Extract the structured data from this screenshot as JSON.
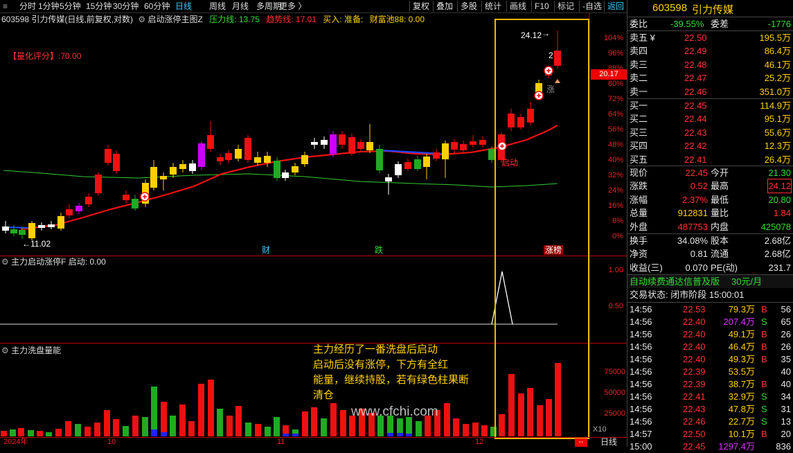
{
  "toolbar": {
    "left": [
      "分时",
      "1分钟",
      "5分钟",
      "15分钟",
      "30分钟",
      "60分钟",
      "日线",
      "周线",
      "月线",
      "多周期",
      "更多 〉"
    ],
    "right": [
      "复权",
      "叠加",
      "多股",
      "统计",
      "画线",
      "F10",
      "标记",
      "-自选",
      "返回"
    ],
    "active_left": "日线",
    "active_right": "返回"
  },
  "main_header": {
    "code_title": "603598 引力传媒(日线,前复权,对数)",
    "indicator": "启动涨停主图Z",
    "pressure": "压力线: 13.75",
    "trend": "趋势线: 17.01",
    "buy": "买入: 准备:",
    "fund": "财富池88: 0.00"
  },
  "quant_score": "【量化评分】:70.00",
  "price_labels": {
    "high_mark": "24.12",
    "low_mark": "11.02",
    "current": "20.17",
    "count_2": "2",
    "zhang": "涨",
    "qidong": "启动"
  },
  "price_axis": [
    "104%",
    "96%",
    "88%",
    "80%",
    "72%",
    "64%",
    "56%",
    "48%",
    "40%",
    "32%",
    "24%",
    "16%",
    "8%",
    "0%"
  ],
  "event_marks": [
    "财",
    "跌",
    "涨榜"
  ],
  "sub1": {
    "title": "主力启动涨停F  启动: 0.00",
    "axis": [
      "1.00",
      "0.50"
    ]
  },
  "sub2": {
    "title": "主力洗盘量能",
    "axis": [
      "75000",
      "50000",
      "25000"
    ],
    "x10": "X10"
  },
  "annotation": {
    "l1": "主力经历了一番洗盘后启动",
    "l2": "启动后没有涨停，下方有全红",
    "l3": "能量，继续持股，若有绿色柱果断",
    "l4": "清仓"
  },
  "watermark": "www.cfchi.com",
  "date_axis": [
    "2024年",
    "10",
    "11",
    "12"
  ],
  "period_tag": "日线",
  "minus_tag": "--",
  "stock": {
    "code": "603598",
    "name": "引力传媒"
  },
  "weibi": {
    "label": "委比",
    "value": "-39.55%",
    "label2": "委差",
    "value2": "-1776"
  },
  "asks": [
    {
      "label": "卖五 ¥",
      "price": "22.50",
      "vol": "195.5万"
    },
    {
      "label": "卖四",
      "price": "22.49",
      "vol": "86.4万"
    },
    {
      "label": "卖三",
      "price": "22.48",
      "vol": "46.1万"
    },
    {
      "label": "卖二",
      "price": "22.47",
      "vol": "25.2万"
    },
    {
      "label": "卖一",
      "price": "22.46",
      "vol": "351.0万"
    }
  ],
  "bids": [
    {
      "label": "买一",
      "price": "22.45",
      "vol": "114.9万"
    },
    {
      "label": "买二",
      "price": "22.44",
      "vol": "95.1万"
    },
    {
      "label": "买三",
      "price": "22.43",
      "vol": "55.6万"
    },
    {
      "label": "买四",
      "price": "22.42",
      "vol": "12.3万"
    },
    {
      "label": "买五",
      "price": "22.41",
      "vol": "26.4万"
    }
  ],
  "stats": [
    {
      "l1": "现价",
      "v1": "22.45",
      "c1": "red",
      "l2": "今开",
      "v2": "21.30",
      "c2": "green"
    },
    {
      "l1": "涨跌",
      "v1": "0.52",
      "c1": "red",
      "l2": "最高",
      "v2": "24.12",
      "c2": "red"
    },
    {
      "l1": "涨幅",
      "v1": "2.37%",
      "c1": "red",
      "l2": "最低",
      "v2": "20.80",
      "c2": "green"
    },
    {
      "l1": "总量",
      "v1": "912831",
      "c1": "yel",
      "l2": "量比",
      "v2": "1.84",
      "c2": "red"
    },
    {
      "l1": "外盘",
      "v1": "487753",
      "c1": "red",
      "l2": "内盘",
      "v2": "425078",
      "c2": "green"
    }
  ],
  "stats2": [
    {
      "l1": "换手",
      "v1": "34.08%",
      "l2": "股本",
      "v2": "2.68亿"
    },
    {
      "l1": "净资",
      "v1": "0.81",
      "l2": "流通",
      "v2": "2.68亿"
    },
    {
      "l1": "收益(三)",
      "v1": "0.070",
      "l2": "PE(动)",
      "v2": "231.7"
    }
  ],
  "promo": {
    "text": "自动续费通达信普及版",
    "price": "30元/月"
  },
  "trade_status": "交易状态: 闭市阶段 15:00:01",
  "ticks": [
    {
      "t": "14:56",
      "p": "22.53",
      "v": "79.3万",
      "d": "B",
      "n": "56",
      "pc": "red",
      "vc": "yel",
      "dc": "red"
    },
    {
      "t": "14:56",
      "p": "22.40",
      "v": "207.4万",
      "d": "S",
      "n": "65",
      "pc": "red",
      "vc": "mag",
      "dc": "green"
    },
    {
      "t": "14:56",
      "p": "22.40",
      "v": "49.1万",
      "d": "B",
      "n": "26",
      "pc": "red",
      "vc": "yel",
      "dc": "red"
    },
    {
      "t": "14:56",
      "p": "22.40",
      "v": "46.4万",
      "d": "B",
      "n": "26",
      "pc": "red",
      "vc": "yel",
      "dc": "red"
    },
    {
      "t": "14:56",
      "p": "22.40",
      "v": "49.3万",
      "d": "B",
      "n": "35",
      "pc": "red",
      "vc": "yel",
      "dc": "red"
    },
    {
      "t": "14:56",
      "p": "22.39",
      "v": "53.5万",
      "d": "",
      "n": "40",
      "pc": "red",
      "vc": "yel",
      "dc": "red"
    },
    {
      "t": "14:56",
      "p": "22.39",
      "v": "38.7万",
      "d": "B",
      "n": "40",
      "pc": "red",
      "vc": "yel",
      "dc": "red"
    },
    {
      "t": "14:56",
      "p": "22.41",
      "v": "32.9万",
      "d": "S",
      "n": "34",
      "pc": "red",
      "vc": "yel",
      "dc": "green"
    },
    {
      "t": "14:56",
      "p": "22.43",
      "v": "47.8万",
      "d": "S",
      "n": "31",
      "pc": "red",
      "vc": "yel",
      "dc": "green"
    },
    {
      "t": "14:56",
      "p": "22.46",
      "v": "22.7万",
      "d": "S",
      "n": "13",
      "pc": "red",
      "vc": "yel",
      "dc": "green"
    },
    {
      "t": "14:57",
      "p": "22.50",
      "v": "10.1万",
      "d": "B",
      "n": "20",
      "pc": "red",
      "vc": "yel",
      "dc": "red"
    },
    {
      "t": "15:00",
      "p": "22.45",
      "v": "1297.4万",
      "d": "",
      "n": "836",
      "pc": "red",
      "vc": "mag",
      "dc": "red"
    }
  ]
}
